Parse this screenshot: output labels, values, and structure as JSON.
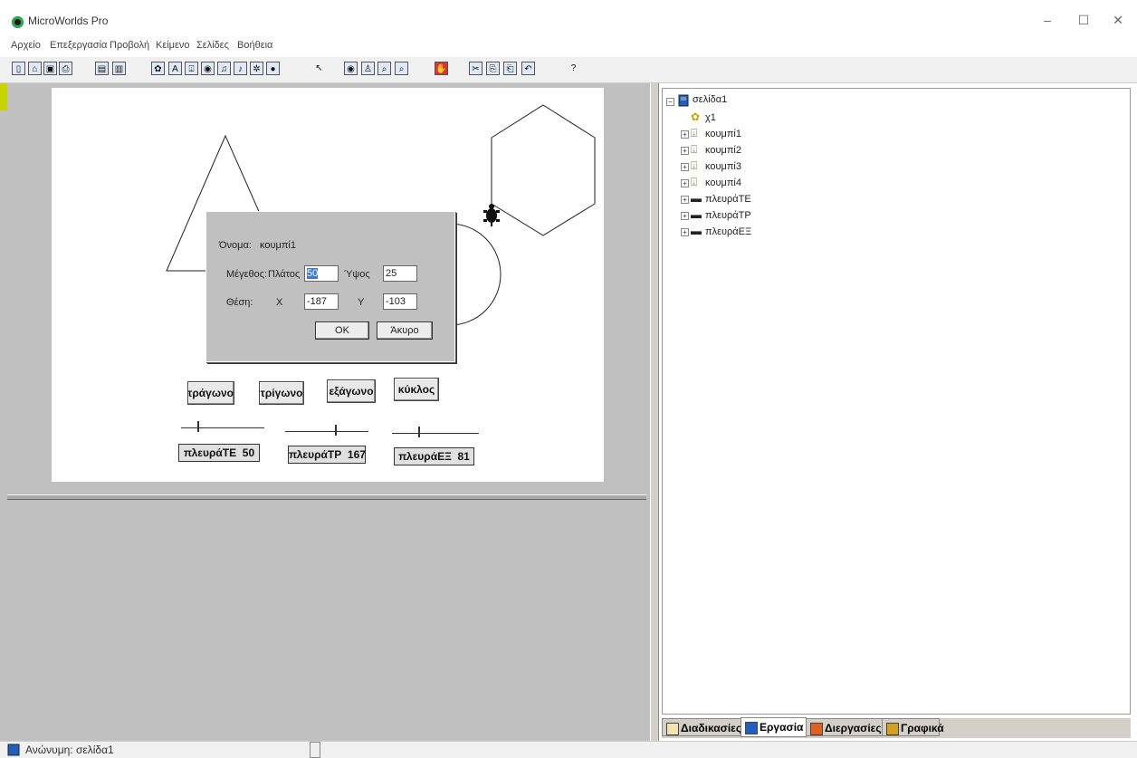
{
  "window": {
    "title": "MicroWorlds Pro",
    "minimize": "–",
    "maximize": "☐",
    "close": "✕"
  },
  "menu": [
    "Αρχείο",
    "Επεξεργασία",
    "Προβολή",
    "Κείμενο",
    "Σελίδες",
    "Βοήθεια"
  ],
  "toolbar": {
    "icons": [
      "new-icon",
      "open-icon",
      "save-icon",
      "print-icon",
      "page-icon",
      "notes-icon",
      "turtle-tool-icon",
      "text-box-icon",
      "button-tool-icon",
      "slider-tool-icon",
      "music-icon",
      "melody-icon",
      "shapes-icon",
      "record-icon",
      "pointer-icon",
      "eye-icon",
      "stamp-icon",
      "zoom-in-icon",
      "zoom-out-icon",
      "stop-icon",
      "cut-icon",
      "copy-icon",
      "paste-icon",
      "undo-icon",
      "help-icon"
    ],
    "glyphs": [
      "▯",
      "⌂",
      "▣",
      "⎙",
      "▤",
      "▥",
      "✿",
      "A",
      "⍗",
      "◉",
      "♫",
      "♪",
      "✲",
      "●",
      "↖",
      "◉",
      "♙",
      "⌕",
      "⌕",
      "✋",
      "✂",
      "⎘",
      "⎗",
      "↶",
      "?"
    ]
  },
  "page_buttons": {
    "square": "τετράγωνο",
    "triangle": "τρίγωνο",
    "hexagon": "εξάγωνο",
    "circle": "κύκλος"
  },
  "sliders": [
    {
      "name": "πλευράΤΕ",
      "value": "50",
      "fraction": 0.2
    },
    {
      "name": "πλευράΤΡ",
      "value": "167",
      "fraction": 0.6
    },
    {
      "name": "πλευράΕΞ",
      "value": "81",
      "fraction": 0.3
    }
  ],
  "dialog": {
    "name_label": "Όνομα:",
    "name_value": "κουμπί1",
    "size_label": "Μέγεθος:",
    "width_label": "Πλάτος",
    "width_value": "50",
    "height_label": "Ύψος",
    "height_value": "25",
    "position_label": "Θέση:",
    "x_label": "X",
    "x_value": "-187",
    "y_label": "Y",
    "y_value": "-103",
    "ok_label": "OK",
    "cancel_label": "Άκυρο"
  },
  "tree": {
    "root": "σελίδα1",
    "children": [
      {
        "label": "χ1",
        "icon": "turtle-icon",
        "expandable": false
      },
      {
        "label": "κουμπί1",
        "icon": "button-icon",
        "expandable": true
      },
      {
        "label": "κουμπί2",
        "icon": "button-icon",
        "expandable": true
      },
      {
        "label": "κουμπί3",
        "icon": "button-icon",
        "expandable": true
      },
      {
        "label": "κουμπί4",
        "icon": "button-icon",
        "expandable": true
      },
      {
        "label": "πλευράΤΕ",
        "icon": "slider-icon",
        "expandable": true
      },
      {
        "label": "πλευράΤΡ",
        "icon": "slider-icon",
        "expandable": true
      },
      {
        "label": "πλευράΕΞ",
        "icon": "slider-icon",
        "expandable": true
      }
    ]
  },
  "tabs": [
    {
      "label": "Διαδικασίες",
      "icon": "procedures-icon",
      "active": false
    },
    {
      "label": "Εργασία",
      "icon": "project-icon",
      "active": true
    },
    {
      "label": "Διεργασίες",
      "icon": "processes-icon",
      "active": false
    },
    {
      "label": "Γραφικά",
      "icon": "graphics-icon",
      "active": false
    }
  ],
  "status": {
    "text": "Ανώνυμη: σελίδα1"
  },
  "colors": {
    "workspace_gray": "#c0c0c0",
    "selection_blue": "#3b78d8"
  }
}
